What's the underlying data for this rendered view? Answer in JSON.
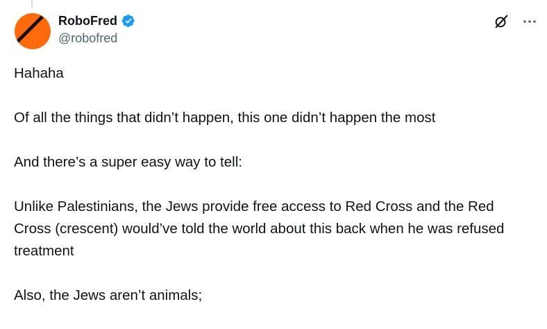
{
  "author": {
    "display_name": "RoboFred",
    "handle": "@robofred",
    "verified": true,
    "avatar_color": "#ff6a0d"
  },
  "icons": {
    "grok": "grok-icon",
    "more": "more-icon",
    "verified": "verified-badge-icon"
  },
  "colors": {
    "verified_blue": "#1d9bf0",
    "text": "#0f1419",
    "muted": "#536471"
  },
  "tweet": {
    "paragraphs": [
      "Hahaha",
      "Of all the things that didn’t happen, this one didn’t happen the most",
      "And there’s a super easy way to tell:",
      "Unlike Palestinians, the Jews provide free access to Red Cross and the Red Cross (crescent) would’ve told the world about this back when he was refused treatment",
      "Also, the Jews aren’t animals;"
    ]
  }
}
